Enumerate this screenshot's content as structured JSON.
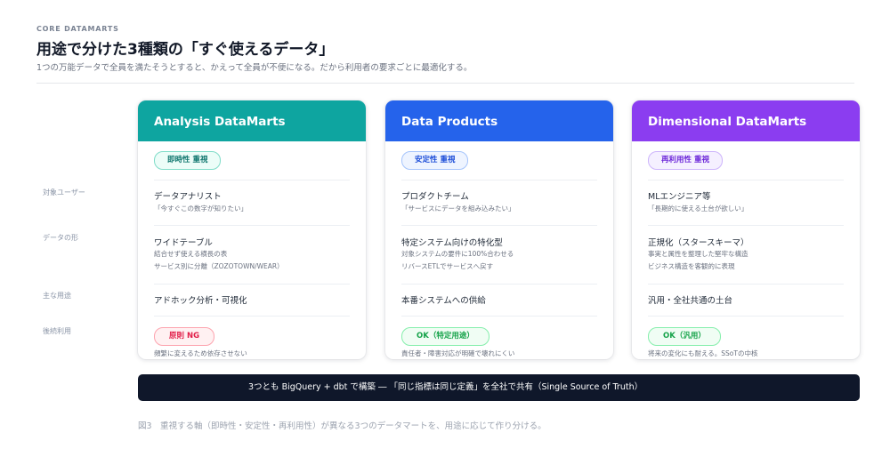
{
  "header": {
    "eyebrow": "CORE DATAMARTS",
    "title": "用途で分けた3種類の「すぐ使えるデータ」",
    "subtitle": "1つの万能データで全員を満たそうとすると、かえって全員が不便になる。だから利用者の要求ごとに最適化する。"
  },
  "row_labels": {
    "target_user": "対象ユーザー",
    "data_shape": "データの形",
    "main_use": "主な用途",
    "downstream": "後続利用"
  },
  "colors": {
    "analysis": "#0ea5a0",
    "products": "#2563eb",
    "dimensional": "#8b3df0",
    "ng": "#e11d48",
    "ok": "#16a34a"
  },
  "cards": [
    {
      "title": "Analysis DataMarts",
      "focus": "即時性 重視",
      "user_main": "データアナリスト",
      "user_sub": "「今すぐこの数字が知りたい」",
      "shape_main": "ワイドテーブル",
      "shape_sub1": "結合せず使える横長の表",
      "shape_sub2": "サービス別に分離（ZOZOTOWN/WEAR）",
      "use_main": "アドホック分析・可視化",
      "status": "原則 NG",
      "status_note": "頻繁に変えるため依存させない"
    },
    {
      "title": "Data Products",
      "focus": "安定性 重視",
      "user_main": "プロダクトチーム",
      "user_sub": "「サービスにデータを組み込みたい」",
      "shape_main": "特定システム向けの特化型",
      "shape_sub1": "対象システムの要件に100%合わせる",
      "shape_sub2": "リバースETLでサービスへ戻す",
      "use_main": "本番システムへの供給",
      "status": "OK（特定用途）",
      "status_note": "責任者・障害対応が明確で壊れにくい"
    },
    {
      "title": "Dimensional DataMarts",
      "focus": "再利用性 重視",
      "user_main": "MLエンジニア等",
      "user_sub": "「長期的に使える土台が欲しい」",
      "shape_main": "正規化（スタースキーマ）",
      "shape_sub1": "事実と属性を整理した堅牢な構造",
      "shape_sub2": "ビジネス構造を客観的に表現",
      "use_main": "汎用・全社共通の土台",
      "status": "OK（汎用）",
      "status_note": "将来の変化にも耐える。SSoTの中核"
    }
  ],
  "banner": "3つとも BigQuery + dbt で構築 ― 「同じ指標は同じ定義」を全社で共有（Single Source of Truth）",
  "caption": "図3　重視する軸（即時性・安定性・再利用性）が異なる3つのデータマートを、用途に応じて作り分ける。"
}
